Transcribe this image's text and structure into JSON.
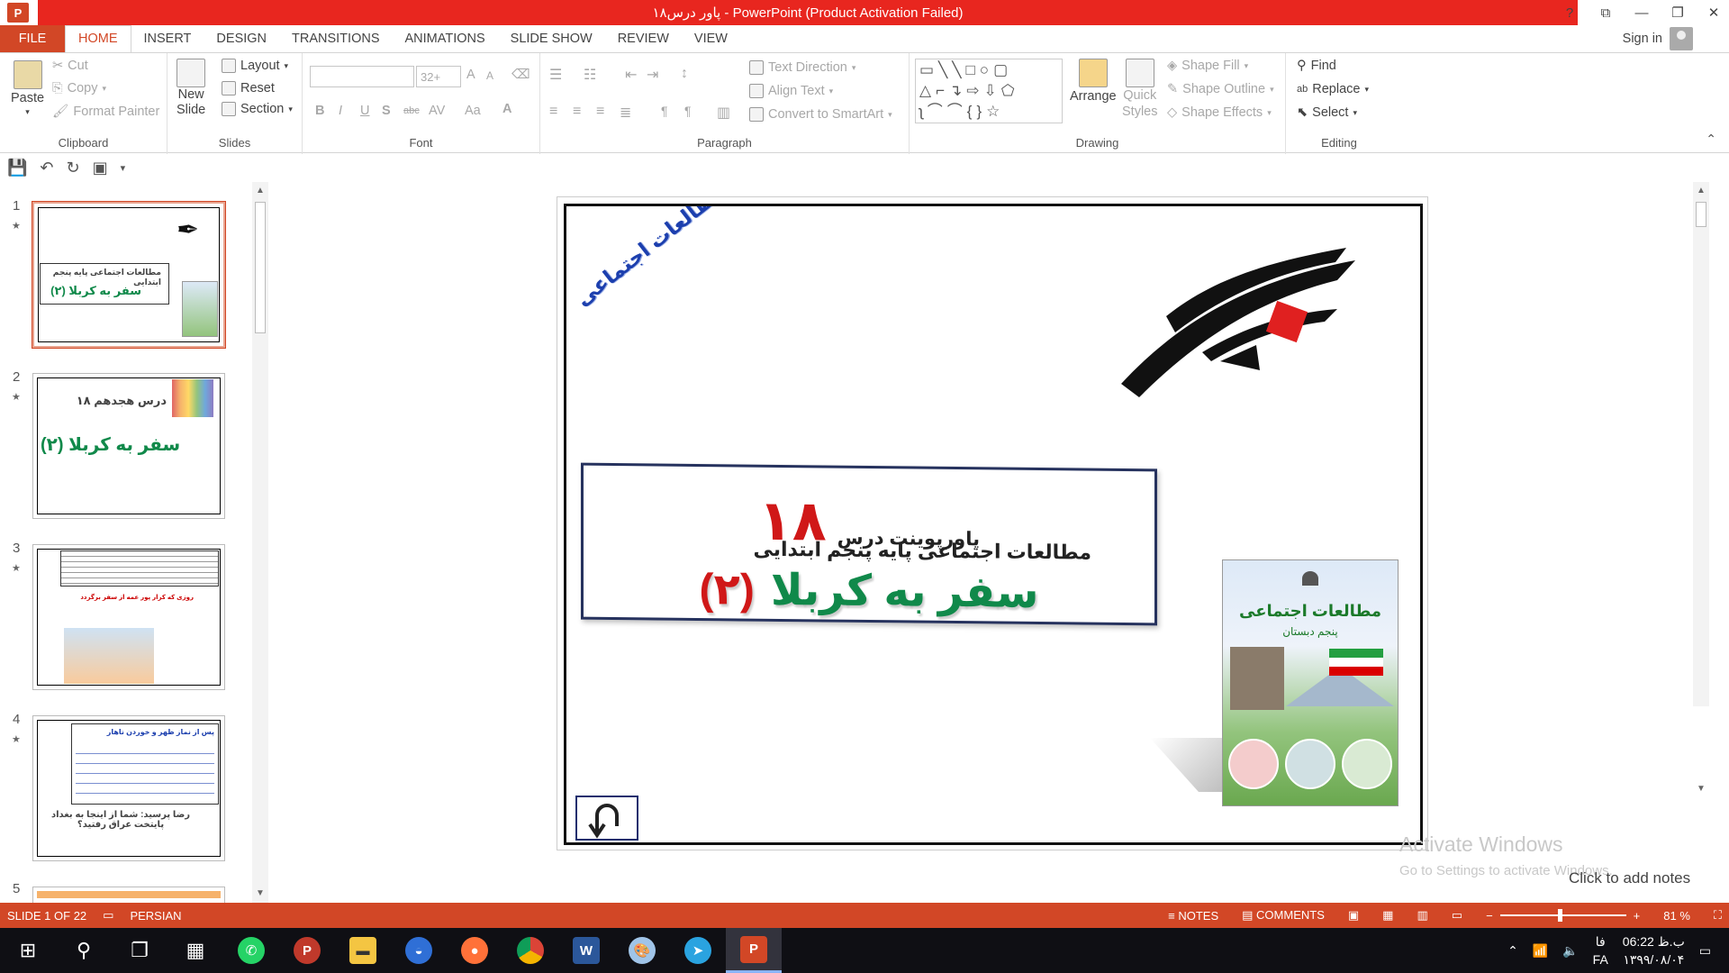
{
  "window": {
    "title": "پاور درس۱۸  -  PowerPoint (Product Activation Failed)",
    "app_logo": "P",
    "controls": [
      "?",
      "⧉",
      "—",
      "❐",
      "✕"
    ]
  },
  "tabs": [
    "FILE",
    "HOME",
    "INSERT",
    "DESIGN",
    "TRANSITIONS",
    "ANIMATIONS",
    "SLIDE SHOW",
    "REVIEW",
    "VIEW"
  ],
  "active_tab": "HOME",
  "signin": "Sign in",
  "ribbon": {
    "clipboard": {
      "paste": "Paste",
      "cut": "Cut",
      "copy": "Copy",
      "format_painter": "Format Painter",
      "label": "Clipboard"
    },
    "slides": {
      "new_slide": "New",
      "new_slide2": "Slide",
      "layout": "Layout",
      "reset": "Reset",
      "section": "Section",
      "label": "Slides"
    },
    "font": {
      "size": "32+",
      "bold": "B",
      "italic": "I",
      "underline": "U",
      "shadow": "S",
      "strike": "abc",
      "spacing": "AV",
      "case": "Aa",
      "color": "A",
      "grow": "A",
      "shrink": "A",
      "label": "Font"
    },
    "paragraph": {
      "text_direction": "Text Direction",
      "align_text": "Align Text",
      "smartart": "Convert to SmartArt",
      "label": "Paragraph"
    },
    "drawing": {
      "arrange": "Arrange",
      "quick_styles": "Quick",
      "quick_styles2": "Styles",
      "shape_fill": "Shape Fill",
      "shape_outline": "Shape Outline",
      "shape_effects": "Shape Effects",
      "label": "Drawing"
    },
    "editing": {
      "find": "Find",
      "replace": "Replace",
      "select": "Select",
      "label": "Editing"
    }
  },
  "thumbnails": [
    {
      "num": "1",
      "text": "سفر به کربلا (۲)",
      "sub": "مطالعات اجتماعی پایه پنجم ابتدایی"
    },
    {
      "num": "2",
      "text": "درس هجدهم ۱۸",
      "sub": "سفر به کربلا (۲)"
    },
    {
      "num": "3",
      "text": "روزی که کرار پور عمه از سفر برگردد",
      "sub": ""
    },
    {
      "num": "4",
      "text": "پس از نماز ظهر و خوردن ناهار",
      "sub": "رضا پرسید: شما از اینجا به بغداد پایتخت عراق رفتید؟"
    },
    {
      "num": "5",
      "text": "",
      "sub": ""
    }
  ],
  "slide": {
    "corner_label": "مطالعات اجتماعی",
    "title_prefix": "پاورپوینت درس",
    "lesson_number": "۱۸",
    "title_course": "مطالعات اجتماعی پایه پنجم ابتدایی",
    "title_main_green": "سفر به کربلا",
    "title_main_red": "(۲)",
    "book_title": "مطالعات اجتماعی",
    "book_sub": "پنجم دبستان"
  },
  "watermark": {
    "line1": "Activate Windows",
    "line2": "Go to Settings to activate Windows."
  },
  "notes_hint": "Click to add notes",
  "status": {
    "slide_info": "SLIDE 1 OF 22",
    "language": "PERSIAN",
    "notes": "NOTES",
    "comments": "COMMENTS",
    "zoom": "81 %"
  },
  "taskbar": {
    "apps": [
      "start",
      "search",
      "task-view",
      "calculator",
      "whatsapp",
      "pdf",
      "explorer",
      "app-blue",
      "firefox",
      "chrome",
      "word",
      "paint",
      "telegram",
      "powerpoint"
    ],
    "lang1": "فا",
    "lang2": "FA",
    "time": "06:22 ب.ظ",
    "date": "۱۳۹۹/۰۸/۰۴"
  },
  "colors": {
    "accent": "#d24726",
    "title_red": "#e8261f",
    "green": "#10894a",
    "red": "#d01818"
  }
}
